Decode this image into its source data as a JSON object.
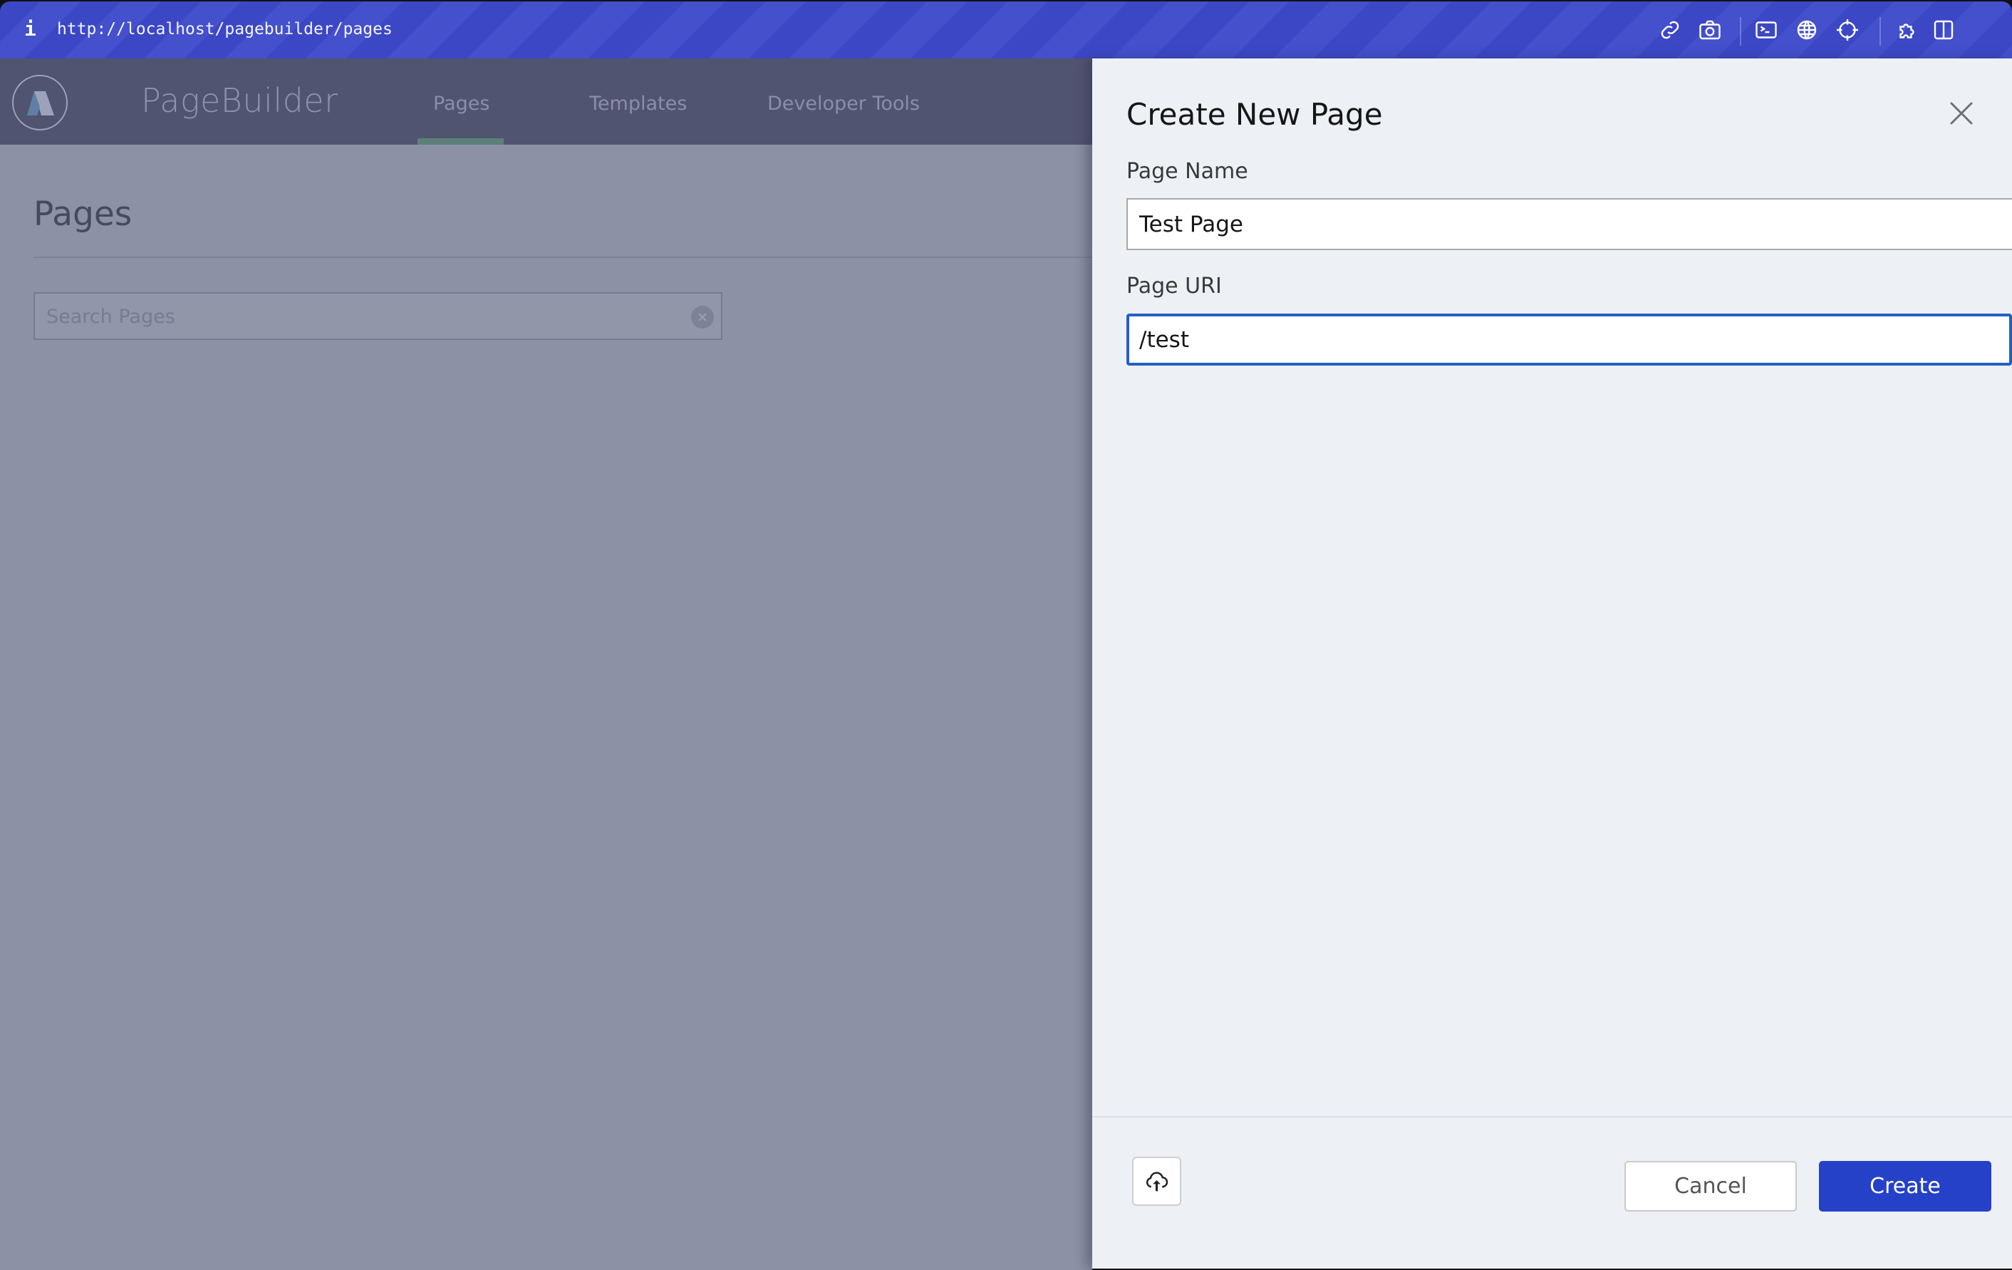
{
  "browser": {
    "url": "http://localhost/pagebuilder/pages",
    "info_icon": "i",
    "tools": [
      "link-icon",
      "camera-icon",
      "terminal-icon",
      "globe-icon",
      "crosshair-icon",
      "puzzle-icon",
      "split-view-icon"
    ]
  },
  "app": {
    "title": "PageBuilder",
    "nav": [
      {
        "label": "Pages",
        "active": true
      },
      {
        "label": "Templates",
        "active": false
      },
      {
        "label": "Developer Tools",
        "active": false
      }
    ],
    "accent_underline": "#5c7f7a"
  },
  "content": {
    "heading": "Pages",
    "search": {
      "placeholder": "Search Pages",
      "value": ""
    }
  },
  "drawer": {
    "title": "Create New Page",
    "fields": [
      {
        "label": "Page Name",
        "value": "Test Page",
        "focused": false
      },
      {
        "label": "Page URI",
        "value": "/test",
        "focused": true
      }
    ],
    "buttons": {
      "cancel": "Cancel",
      "create": "Create"
    },
    "primary_color": "#2541c8",
    "focus_color": "#2360c4"
  }
}
